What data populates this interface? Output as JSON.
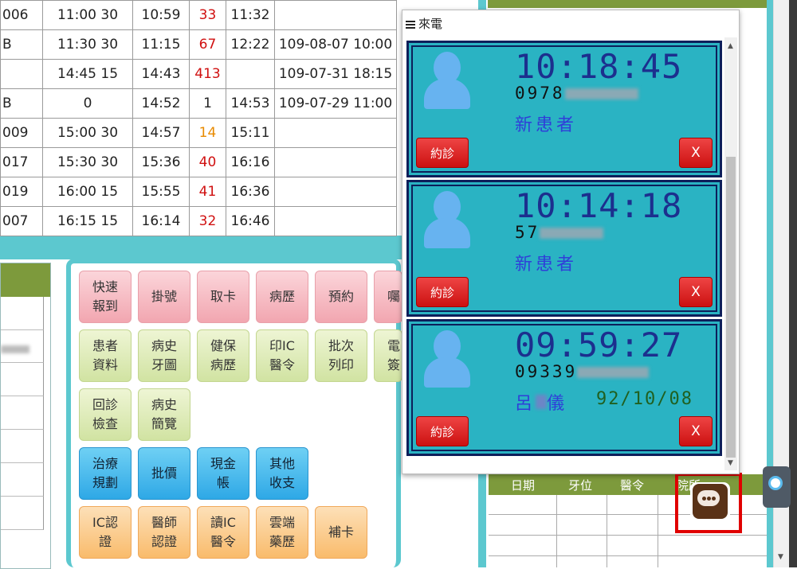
{
  "appointments": [
    {
      "c0": "006",
      "c1": "11:00 30",
      "c2": "10:59",
      "c3": "33",
      "c3_color": "red",
      "c4": "11:32",
      "c5": ""
    },
    {
      "c0": "B",
      "c1": "11:30 30",
      "c2": "11:15",
      "c3": "67",
      "c3_color": "red",
      "c4": "12:22",
      "c5": "109-08-07 10:00"
    },
    {
      "c0": "",
      "c1": "14:45 15",
      "c2": "14:43",
      "c3": "413",
      "c3_color": "red",
      "c4": "",
      "c5": "109-07-31 18:15"
    },
    {
      "c0": "B",
      "c1": "0",
      "c2": "14:52",
      "c3": "1",
      "c3_color": "black",
      "c4": "14:53",
      "c5": "109-07-29 11:00"
    },
    {
      "c0": "009",
      "c1": "15:00 30",
      "c2": "14:57",
      "c3": "14",
      "c3_color": "orange",
      "c4": "15:11",
      "c5": ""
    },
    {
      "c0": "017",
      "c1": "15:30 30",
      "c2": "15:36",
      "c3": "40",
      "c3_color": "red",
      "c4": "16:16",
      "c5": ""
    },
    {
      "c0": "019",
      "c1": "16:00 15",
      "c2": "15:55",
      "c3": "41",
      "c3_color": "red",
      "c4": "16:36",
      "c5": ""
    },
    {
      "c0": "007",
      "c1": "16:15 15",
      "c2": "16:14",
      "c3": "32",
      "c3_color": "red",
      "c4": "16:46",
      "c5": ""
    }
  ],
  "buttons": {
    "quick_checkin": "快速\n報到",
    "register": "掛號",
    "get_card": "取卡",
    "history": "病歷",
    "appointment": "預約",
    "partial_sixth": "囑",
    "patient_info": "患者\n資料",
    "history_chart": "病史\n牙圖",
    "nhi_history": "健保\n病歷",
    "print_ic": "印IC\n醫令",
    "batch_print": "批次\n列印",
    "partial_e": "電\n簽",
    "recall_check": "回診\n檢查",
    "history_browse": "病史\n簡覽",
    "treatment_plan": "治療\n規劃",
    "batch_price": "批價",
    "cash_account": "現金\n帳",
    "other_income": "其他\n收支",
    "ic_verify": "IC認\n證",
    "doctor_verify": "醫師\n認證",
    "read_ic": "讀IC\n醫令",
    "cloud_meds": "雲端\n藥歷",
    "replace_card": "補卡"
  },
  "right_table": {
    "headers": [
      "日期",
      "牙位",
      "醫令",
      "院所"
    ]
  },
  "popup": {
    "title": "來電",
    "calls": [
      {
        "time": "10:18:45",
        "phone_visible": "0978",
        "name": "新患者",
        "date": ""
      },
      {
        "time": "10:14:18",
        "phone_visible": "57",
        "name": "新患者",
        "date": ""
      },
      {
        "time": "09:59:27",
        "phone_visible": "09339",
        "name": "呂",
        "name_tail": "儀",
        "date": "92/10/08"
      }
    ],
    "book_label": "約診",
    "close_label": "X"
  },
  "colors": {
    "header_green": "#7d9a3c",
    "teal": "#5cc8cf",
    "card_teal": "#2ab3c3",
    "time_blue": "#1c2f8e",
    "alert_red": "#e00000"
  },
  "icons": [
    "hamburger-icon",
    "user-avatar-icon",
    "chat-bubble-icon",
    "teamviewer-icon"
  ]
}
